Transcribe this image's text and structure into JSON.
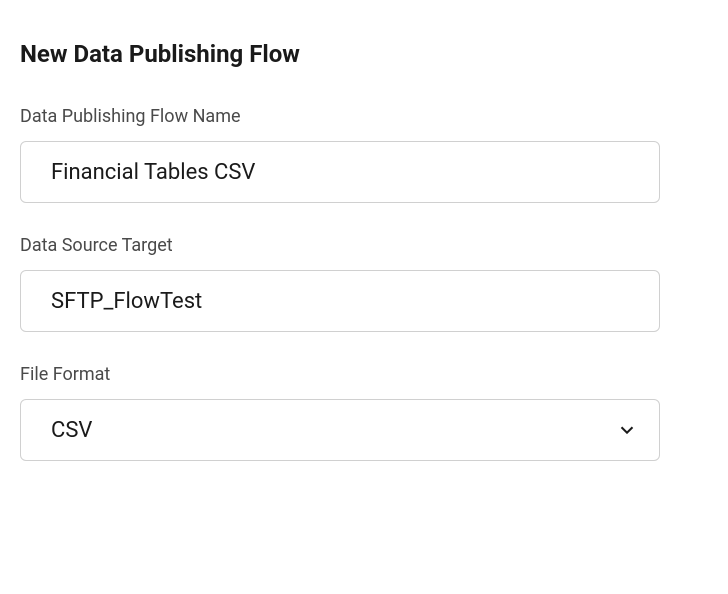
{
  "form": {
    "title": "New Data Publishing Flow",
    "fields": {
      "flowName": {
        "label": "Data Publishing Flow Name",
        "value": "Financial Tables CSV"
      },
      "dataSourceTarget": {
        "label": "Data Source Target",
        "value": "SFTP_FlowTest"
      },
      "fileFormat": {
        "label": "File Format",
        "value": "CSV"
      }
    }
  }
}
